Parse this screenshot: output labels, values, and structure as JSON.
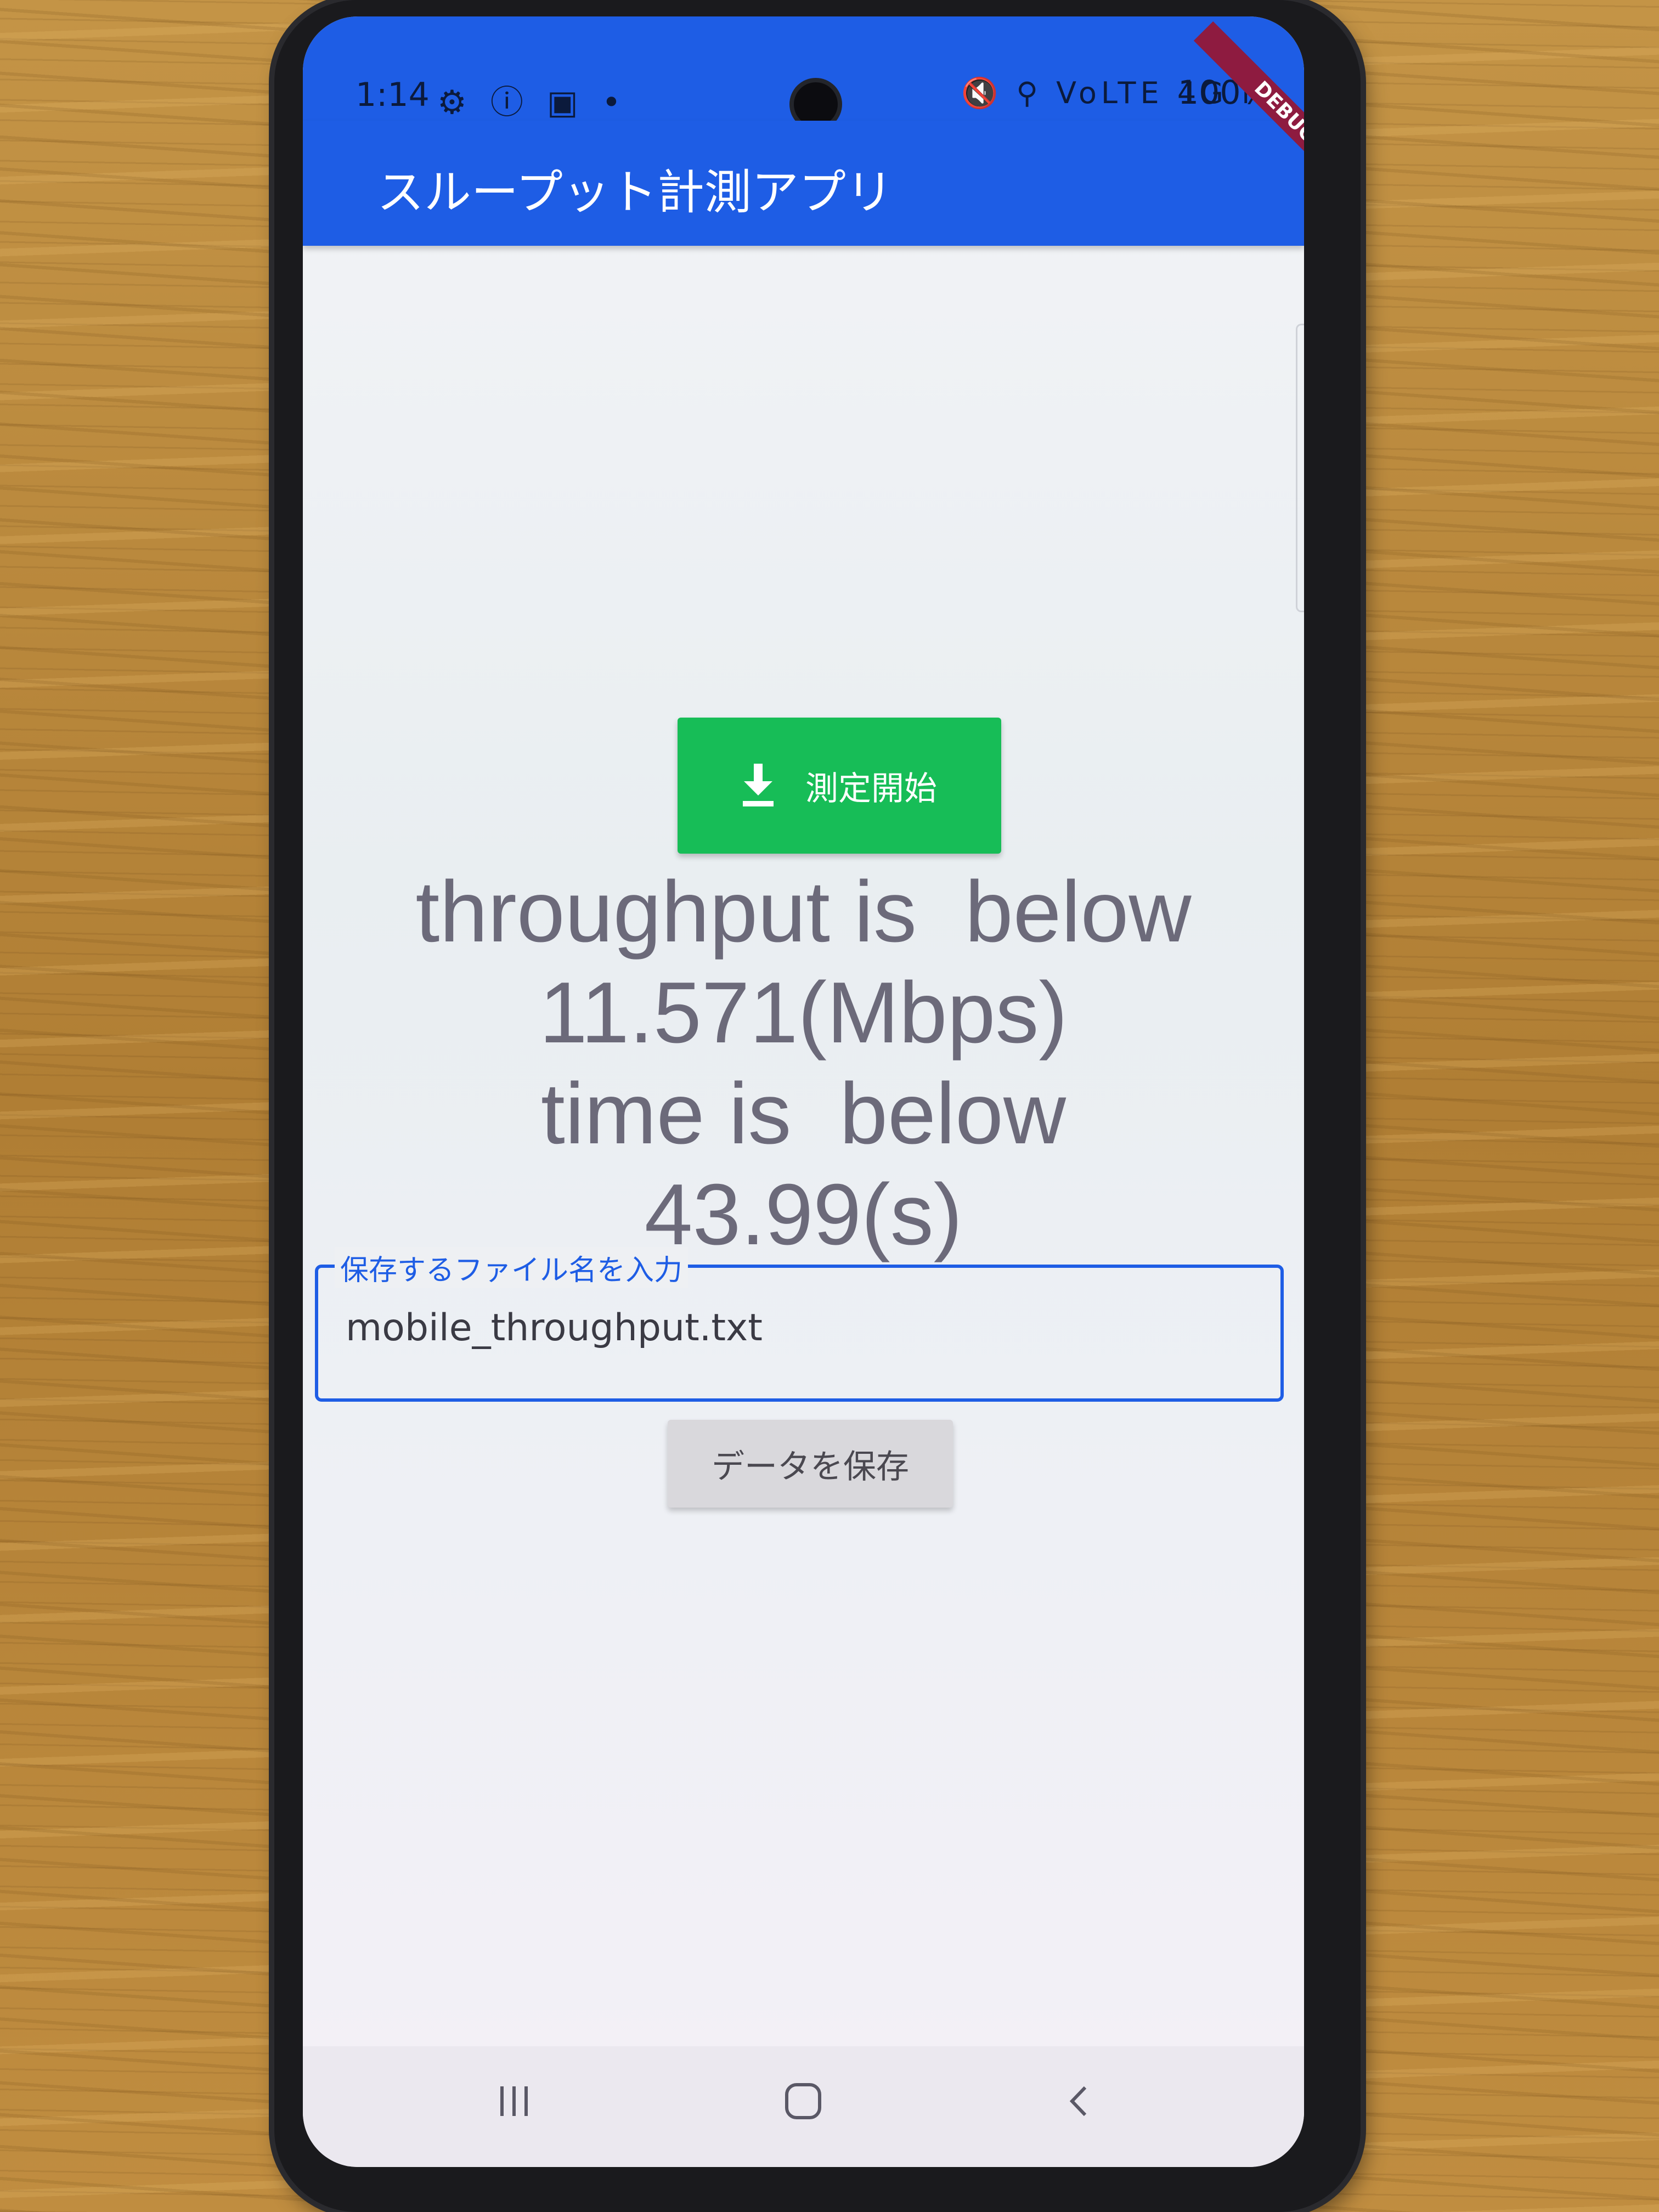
{
  "status_bar": {
    "time": "1:14",
    "left_icons": "⚙ ⓘ ▣ •",
    "right_icons": "🔇 ⚲ VoLTE 4G ıl",
    "battery": "100%"
  },
  "debug_banner": "DEBUG",
  "app_bar": {
    "title": "スループット計測アプリ"
  },
  "measure_button": {
    "icon": "download-icon",
    "label": "測定開始"
  },
  "result": {
    "line1": "throughput is  below",
    "line2": "11.571(Mbps)",
    "line3": "time is  below",
    "line4": "43.99(s)"
  },
  "filename_field": {
    "label": "保存するファイル名を入力",
    "value": "mobile_throughput.txt"
  },
  "save_button": {
    "label": "データを保存"
  },
  "nav_bar": {
    "recents_icon": "recents-icon",
    "home_icon": "home-icon",
    "back_icon": "back-icon"
  },
  "colors": {
    "app_bar": "#1e5de5",
    "measure_button": "#17bd57",
    "save_button": "#d9d8dc",
    "result_text": "#6c6a7a",
    "debug_ribbon": "#8e1b40"
  }
}
